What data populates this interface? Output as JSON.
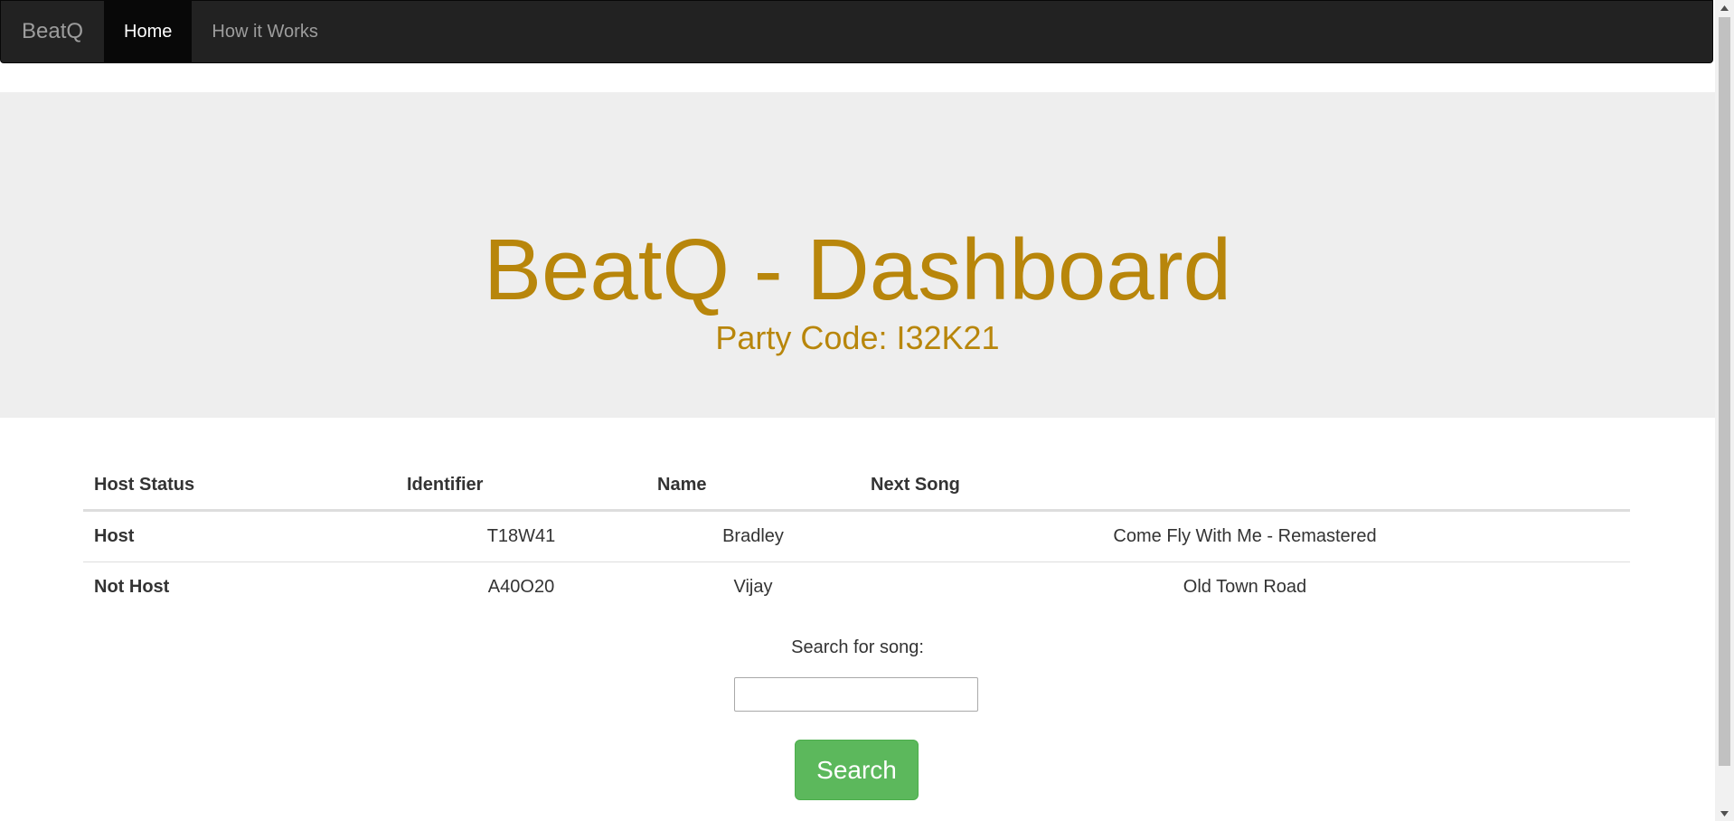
{
  "navbar": {
    "brand": "BeatQ",
    "items": [
      {
        "label": "Home",
        "active": true
      },
      {
        "label": "How it Works",
        "active": false
      }
    ]
  },
  "jumbotron": {
    "title": "BeatQ - Dashboard",
    "party_code": "Party Code: I32K21"
  },
  "table": {
    "headers": [
      "Host Status",
      "Identifier",
      "Name",
      "Next Song"
    ],
    "rows": [
      {
        "status": "Host",
        "identifier": "T18W41",
        "name": "Bradley",
        "next_song": "Come Fly With Me - Remastered"
      },
      {
        "status": "Not Host",
        "identifier": "A40O20",
        "name": "Vijay",
        "next_song": "Old Town Road"
      }
    ]
  },
  "search": {
    "label": "Search for song:",
    "value": "",
    "button_label": "Search"
  },
  "colors": {
    "navbar_bg": "#222222",
    "accent_gold": "#b8860b",
    "jumbotron_bg": "#eeeeee",
    "button_green": "#5cb85c"
  },
  "icons": {
    "scroll_up": "triangle-up-icon",
    "scroll_down": "triangle-down-icon"
  }
}
